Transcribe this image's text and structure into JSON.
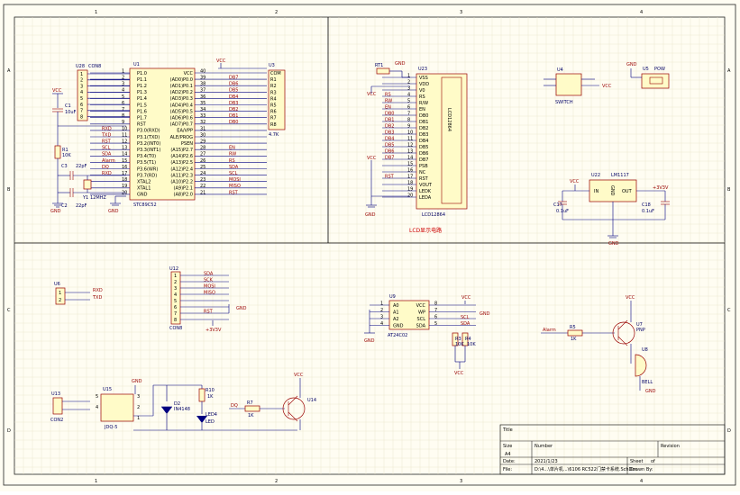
{
  "border": {
    "cols": [
      "1",
      "2",
      "3",
      "4"
    ],
    "rows": [
      "A",
      "B",
      "C",
      "D"
    ]
  },
  "mcu": {
    "ref": "U1",
    "part": "STC89C52",
    "left_pins": [
      "P1.0",
      "P1.1",
      "P1.2",
      "P1.3",
      "P1.4",
      "P1.5",
      "P1.6",
      "P1.7",
      "RST",
      "P3.0(RXD)",
      "P3.1(TXD)",
      "P3.2(INT0)",
      "P3.3(INT1)",
      "P3.4(T0)",
      "P3.5(T1)",
      "P3.6(WR)",
      "P3.7(RD)",
      "XTAL2",
      "XTAL1",
      "GND"
    ],
    "left_nums": [
      "1",
      "2",
      "3",
      "4",
      "5",
      "6",
      "7",
      "8",
      "9",
      "10",
      "11",
      "12",
      "13",
      "14",
      "15",
      "16",
      "17",
      "18",
      "19",
      "20"
    ],
    "right_pins": [
      "VCC",
      "(AD0)P0.0",
      "(AD1)P0.1",
      "(AD2)P0.2",
      "(AD3)P0.3",
      "(AD4)P0.4",
      "(AD5)P0.5",
      "(AD6)P0.6",
      "(AD7)P0.7",
      "EA/VPP",
      "ALE/PROG",
      "PSEN",
      "(A15)P2.7",
      "(A14)P2.6",
      "(A13)P2.5",
      "(A12)P2.4",
      "(A11)P2.3",
      "(A10)P2.2",
      "(A9)P2.1",
      "(A8)P2.0"
    ],
    "right_nums": [
      "40",
      "39",
      "38",
      "37",
      "36",
      "35",
      "34",
      "33",
      "32",
      "31",
      "30",
      "29",
      "28",
      "27",
      "26",
      "25",
      "24",
      "23",
      "22",
      "21"
    ],
    "left_nets": [
      "",
      "",
      "",
      "",
      "",
      "",
      "",
      "",
      "",
      "RXD",
      "TXD",
      "RST",
      "SCL",
      "SDA",
      "Alarm",
      "DQ",
      "RXD",
      "",
      "",
      ""
    ],
    "right_nets": [
      "",
      "DB7",
      "DB6",
      "DB5",
      "DB4",
      "DB3",
      "DB2",
      "DB1",
      "DB0",
      "",
      "",
      "",
      "EN",
      "RW",
      "RS",
      "SDA",
      "SCL",
      "MOSI",
      "MISO",
      "RST"
    ]
  },
  "con8": {
    "ref": "U28",
    "part": "CON8",
    "nums": [
      "1",
      "2",
      "3",
      "4",
      "5",
      "6",
      "7",
      "8"
    ]
  },
  "rpack": {
    "ref": "U3",
    "part": "4.7K",
    "pins": [
      "COM",
      "R1",
      "R2",
      "R3",
      "R4",
      "R5",
      "R6",
      "R7",
      "R8"
    ]
  },
  "reset": {
    "vcc": "VCC",
    "cap_ref": "C1",
    "cap_val": "10uF",
    "res_ref": "R1",
    "res_val": "10K"
  },
  "crystal": {
    "c3": "C3",
    "c3v": "22pF",
    "c2": "C2",
    "c2v": "22pF",
    "y": "Y1",
    "yv": "12MHZ",
    "gnd1": "GND",
    "gnd2": "GND"
  },
  "lcd": {
    "ref": "U23",
    "part": "LCD12864",
    "label": "LCD12864",
    "pins": [
      "VSS",
      "VDD",
      "V0",
      "RS",
      "R/W",
      "EN",
      "DB0",
      "DB1",
      "DB2",
      "DB3",
      "DB4",
      "DB5",
      "DB6",
      "DB7",
      "PSB",
      "NC",
      "RST",
      "VOUT",
      "LEDK",
      "LEDA"
    ],
    "nums": [
      "1",
      "2",
      "3",
      "4",
      "5",
      "6",
      "7",
      "8",
      "9",
      "10",
      "11",
      "12",
      "13",
      "14",
      "15",
      "16",
      "17",
      "18",
      "19",
      "20"
    ],
    "nets": [
      "",
      "",
      "",
      "RS",
      "RW",
      "EN",
      "DB0",
      "DB1",
      "DB2",
      "DB3",
      "DB4",
      "DB5",
      "DB6",
      "DB7",
      "",
      "",
      "RST",
      "",
      "",
      ""
    ],
    "pot_ref": "RT1",
    "title": "LCD显示电路",
    "gnd": "GND",
    "vcc": "VCC"
  },
  "switch": {
    "ref": "U4",
    "part": "SWITCH",
    "vcc": "VCC"
  },
  "power": {
    "ref": "U5",
    "part": "POW",
    "gnd": "GND"
  },
  "reg": {
    "ref": "U22",
    "part": "LM1117",
    "in": "IN",
    "out": "OUT",
    "gnd": "GND",
    "vcc": "VCC",
    "out_net": "+3V3V",
    "c17": "C17",
    "c17v": "0.1uF",
    "c18": "C18",
    "c18v": "0.1uF"
  },
  "uart": {
    "ref": "U6",
    "pins": [
      "1",
      "2"
    ],
    "nets": [
      "RXD",
      "TXD"
    ]
  },
  "u12": {
    "ref": "U12",
    "part": "CON8",
    "nums": [
      "1",
      "2",
      "3",
      "4",
      "5",
      "6",
      "7",
      "8"
    ],
    "nets": [
      "SDA",
      "SCK",
      "MOSI",
      "MISO",
      "",
      "",
      "RST",
      ""
    ],
    "gnd": "GND",
    "v33": "+3V3V"
  },
  "eeprom": {
    "ref": "U9",
    "part": "AT24C02",
    "left": [
      "A0",
      "A1",
      "A2",
      "GND"
    ],
    "lnum": [
      "1",
      "2",
      "3",
      "4"
    ],
    "right": [
      "VCC",
      "WP",
      "SCL",
      "SDA"
    ],
    "rnum": [
      "8",
      "7",
      "6",
      "5"
    ],
    "vcc": "VCC",
    "gnd": "GND",
    "gnd2": "GND",
    "scl": "SCL",
    "sda": "SDA",
    "r3": "R3",
    "r3v": "10K",
    "r4": "R4",
    "r4v": "10K",
    "vcc2": "VCC"
  },
  "buzzer": {
    "ref": "U7",
    "part": "PNP",
    "r5": "R5",
    "r5v": "1K",
    "net": "Alarm",
    "vcc": "VCC",
    "bell": "U8",
    "bellv": "BELL",
    "gnd": "GND"
  },
  "relay": {
    "con": "U13",
    "conv": "CON2",
    "ref": "U15",
    "part": "JDQ-5",
    "gnd": "GND",
    "d": "D2",
    "dv": "IN4148",
    "r10": "R10",
    "r10v": "1K",
    "led": "LED4",
    "ledv": "LED",
    "r7": "R7",
    "r7v": "1K",
    "net": "DQ",
    "q": "U14",
    "vcc": "VCC",
    "nums": [
      "5",
      "4",
      "3",
      "2",
      "1"
    ]
  },
  "title_block": {
    "title_label": "Title",
    "size_label": "Size",
    "size": "A4",
    "number_label": "Number",
    "revision_label": "Revision",
    "date_label": "Date:",
    "date": "2021/1/23",
    "sheet_label": "Sheet",
    "of_label": "of",
    "file_label": "File:",
    "file": "D:\\4...\\单片机...\\6106 RC522门禁卡系统.SchDoc",
    "drawn_label": "Drawn By:"
  }
}
